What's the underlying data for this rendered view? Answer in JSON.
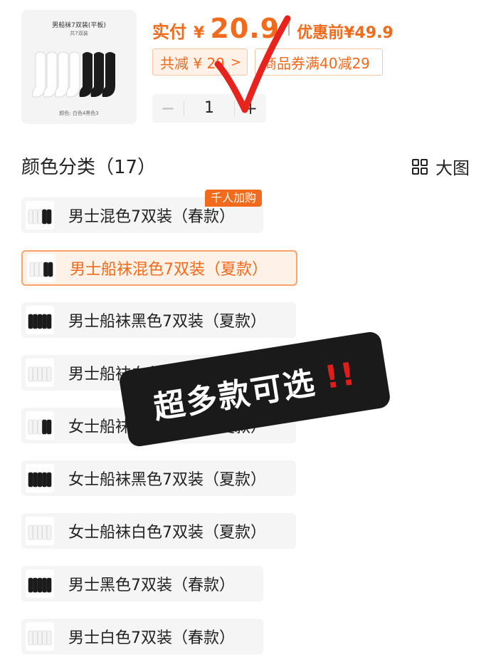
{
  "product": {
    "thumb_title": "男船袜7双装(平板)",
    "thumb_subtitle": "共7双装",
    "thumb_footer": "颜色: 白色4黑色3"
  },
  "price": {
    "label": "实付",
    "currency": "¥",
    "value": "20.9",
    "original_label": "优惠前",
    "original_currency": "¥",
    "original_value": "49.9"
  },
  "tags": {
    "discount": "共减 ¥ 29",
    "discount_chevron": ">",
    "coupon": "商品券满40减29"
  },
  "quantity": {
    "minus": "−",
    "value": "1",
    "plus": "+"
  },
  "variants": {
    "heading": "颜色分类（17）",
    "big_view_label": "大图",
    "hot_badge": "千人加购",
    "items": [
      {
        "label": "男士混色7双装（春款）",
        "thumb": "mixed"
      },
      {
        "label": "男士船袜混色7双装（夏款）",
        "thumb": "mixed",
        "selected": true
      },
      {
        "label": "男士船袜黑色7双装（夏款）",
        "thumb": "black"
      },
      {
        "label": "男士船袜白色7双装（夏款）",
        "thumb": "white"
      },
      {
        "label": "女士船袜混色7双装（夏款）",
        "thumb": "mixed"
      },
      {
        "label": "女士船袜黑色7双装（夏款）",
        "thumb": "black"
      },
      {
        "label": "女士船袜白色7双装（夏款）",
        "thumb": "white"
      },
      {
        "label": "男士黑色7双装（春款）",
        "thumb": "black"
      },
      {
        "label": "男士白色7双装（春款）",
        "thumb": "white"
      }
    ]
  },
  "overlay": {
    "text": "超多款可选",
    "exclaim": "!!"
  },
  "colors": {
    "accent": "#f26a1b",
    "check": "#e8231e",
    "selected_bg": "#fdf1e8"
  }
}
